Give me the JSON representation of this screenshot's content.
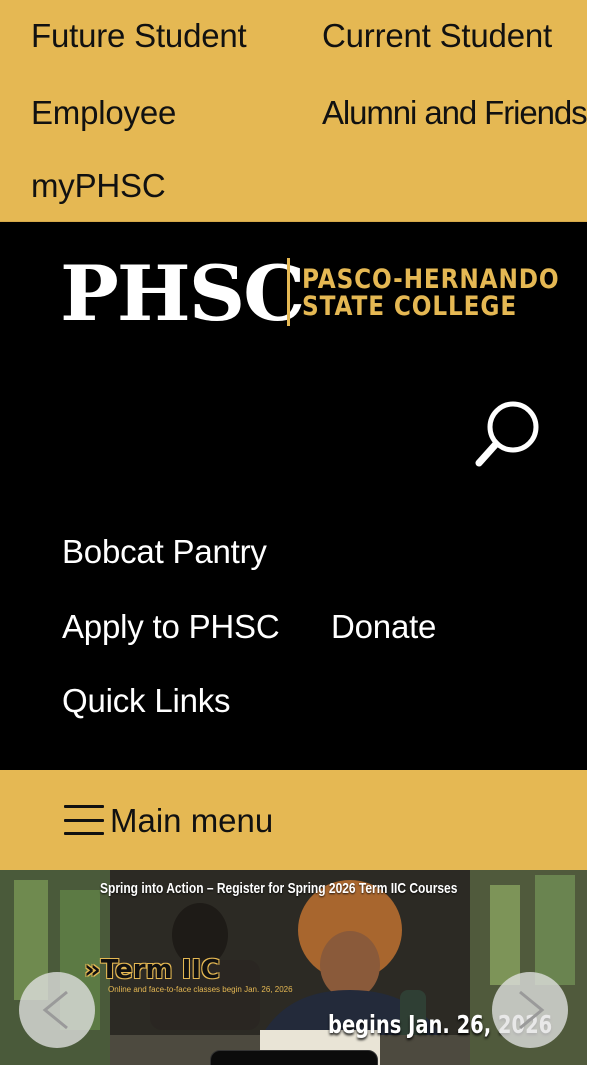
{
  "audience_nav": {
    "future_student": "Future Student",
    "current_student": "Current Student",
    "employee": "Employee",
    "alumni_and_friends": "Alumni and Friends",
    "myphsc": "myPHSC"
  },
  "logo": {
    "abbreviation": "PHSC",
    "name_line_1": "PASCO-HERNANDO",
    "name_line_2": "STATE COLLEGE"
  },
  "search": {
    "icon": "search-icon"
  },
  "header_links": {
    "bobcat_pantry": "Bobcat Pantry",
    "apply": "Apply to PHSC",
    "donate": "Donate",
    "quick_links": "Quick Links"
  },
  "main_menu": {
    "label": "Main menu",
    "icon": "hamburger-icon"
  },
  "hero": {
    "caption_top": "Spring into Action – Register for Spring 2026 Term IIC Courses",
    "badge": "»Term IIC",
    "badge_sub": "Online and face-to-face classes begin Jan. 26, 2026",
    "date_text": "begins Jan. 26, 2026",
    "prev_icon": "chevron-left-icon",
    "next_icon": "chevron-right-icon"
  },
  "colors": {
    "gold": "#e5b853",
    "black": "#000000",
    "white": "#ffffff"
  }
}
